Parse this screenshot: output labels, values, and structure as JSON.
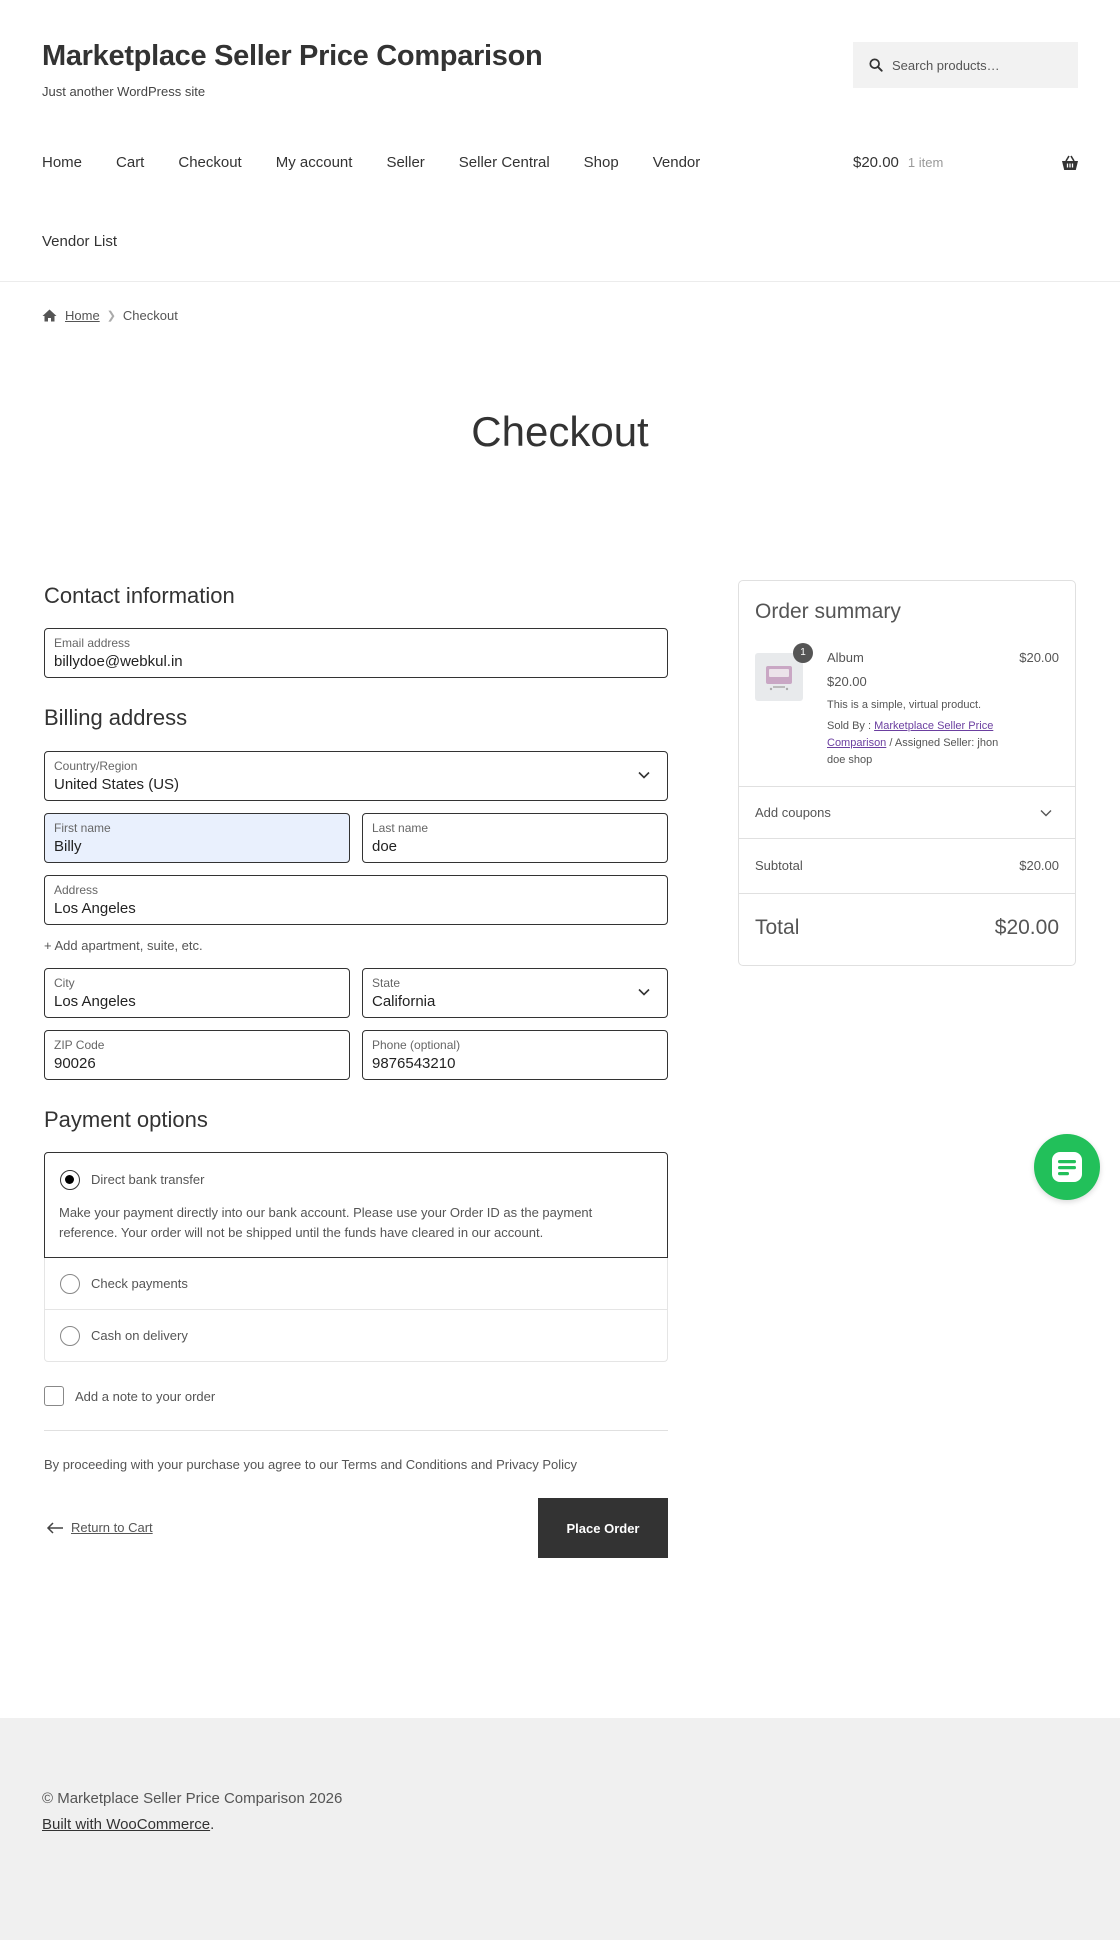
{
  "site": {
    "title": "Marketplace Seller Price Comparison",
    "tagline": "Just another WordPress site"
  },
  "search": {
    "placeholder": "Search products…",
    "icon": "search-icon"
  },
  "nav": {
    "items": [
      "Home",
      "Cart",
      "Checkout",
      "My account",
      "Seller",
      "Seller Central",
      "Shop",
      "Vendor"
    ],
    "row2": "Vendor List"
  },
  "cart": {
    "amount": "$20.00",
    "count": "1 item",
    "icon": "basket-icon"
  },
  "breadcrumb": {
    "home": "Home",
    "current": "Checkout"
  },
  "page_title": "Checkout",
  "contact": {
    "title": "Contact information",
    "email_label": "Email address",
    "email_value": "billydoe@webkul.in"
  },
  "billing": {
    "title": "Billing address",
    "country_label": "Country/Region",
    "country_value": "United States (US)",
    "first_name_label": "First name",
    "first_name_value": "Billy",
    "last_name_label": "Last name",
    "last_name_value": "doe",
    "address_label": "Address",
    "address_value": "Los Angeles",
    "add_apartment": "+ Add apartment, suite, etc.",
    "city_label": "City",
    "city_value": "Los Angeles",
    "state_label": "State",
    "state_value": "California",
    "zip_label": "ZIP Code",
    "zip_value": "90026",
    "phone_label": "Phone (optional)",
    "phone_value": "9876543210"
  },
  "payment": {
    "title": "Payment options",
    "options": [
      {
        "label": "Direct bank transfer",
        "selected": true
      },
      {
        "label": "Check payments",
        "selected": false
      },
      {
        "label": "Cash on delivery",
        "selected": false
      }
    ],
    "bank_description": "Make your payment directly into our bank account. Please use your Order ID as the payment reference. Your order will not be shipped until the funds have cleared in our account."
  },
  "order_note": {
    "label": "Add a note to your order"
  },
  "terms": "By proceeding with your purchase you agree to our Terms and Conditions and Privacy Policy",
  "actions": {
    "return_label": "Return to Cart",
    "place_order": "Place Order"
  },
  "summary": {
    "title": "Order summary",
    "item": {
      "quantity": "1",
      "name": "Album",
      "line_total": "$20.00",
      "price": "$20.00",
      "description": "This is a simple, virtual product.",
      "sold_by_label": "Sold By :",
      "sold_by_link": "Marketplace Seller Price Comparison",
      "assigned": "/ Assigned Seller: jhon doe shop"
    },
    "coupons_label": "Add coupons",
    "subtotal_label": "Subtotal",
    "subtotal_value": "$20.00",
    "total_label": "Total",
    "total_value": "$20.00"
  },
  "footer": {
    "copyright": "© Marketplace Seller Price Comparison 2026",
    "built_with": "Built with WooCommerce"
  },
  "colors": {
    "accent_green": "#22c05a",
    "button_dark": "#333333",
    "link_purple": "#6b3fa0",
    "footer_bg": "#f0f0f0"
  }
}
